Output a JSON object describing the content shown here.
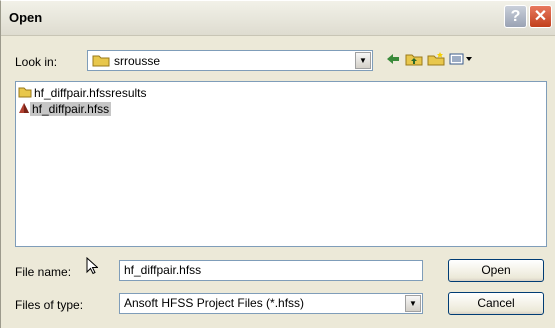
{
  "window": {
    "title": "Open",
    "help_label": "?",
    "close_label": "✕"
  },
  "lookin": {
    "label": "Look in:",
    "value": "srrousse"
  },
  "toolbar": {
    "back_icon": "back-arrow-icon",
    "up_icon": "up-folder-icon",
    "new_folder_icon": "new-folder-icon",
    "views_icon": "views-menu-icon"
  },
  "files": [
    {
      "name": "hf_diffpair.hfssresults",
      "icon": "folder-icon",
      "selected": false
    },
    {
      "name": "hf_diffpair.hfss",
      "icon": "hfss-project-icon",
      "selected": true
    }
  ],
  "filename": {
    "label": "File name:",
    "value": "hf_diffpair.hfss"
  },
  "filetype": {
    "label": "Files of type:",
    "value": "Ansoft HFSS Project Files (*.hfss)"
  },
  "buttons": {
    "open": "Open",
    "cancel": "Cancel"
  },
  "colors": {
    "folder": "#e8c74c",
    "hfss_icon": "#b04030",
    "selection": "#c6c6c6"
  }
}
